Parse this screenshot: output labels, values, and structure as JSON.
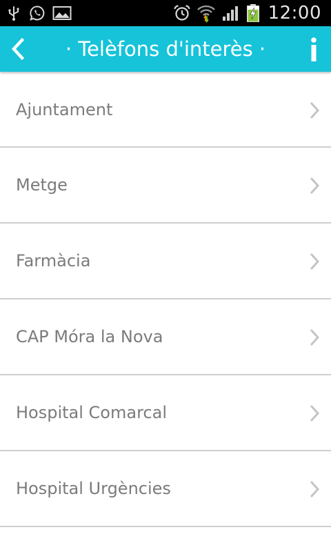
{
  "status_bar": {
    "time": "12:00",
    "icons_left": [
      "usb-icon",
      "whatsapp-icon",
      "gallery-icon"
    ],
    "icons_right": [
      "alarm-icon",
      "wifi-icon",
      "signal-icon",
      "battery-charging-icon"
    ]
  },
  "app_bar": {
    "title": "· Telèfons d'interès ·",
    "back_icon": "chevron-left-icon",
    "info_icon": "info-icon",
    "color": "#16c3d9"
  },
  "contacts": [
    {
      "label": "Ajuntament"
    },
    {
      "label": "Metge"
    },
    {
      "label": "Farmàcia"
    },
    {
      "label": "CAP Móra la Nova"
    },
    {
      "label": "Hospital Comarcal"
    },
    {
      "label": "Hospital Urgències"
    }
  ]
}
